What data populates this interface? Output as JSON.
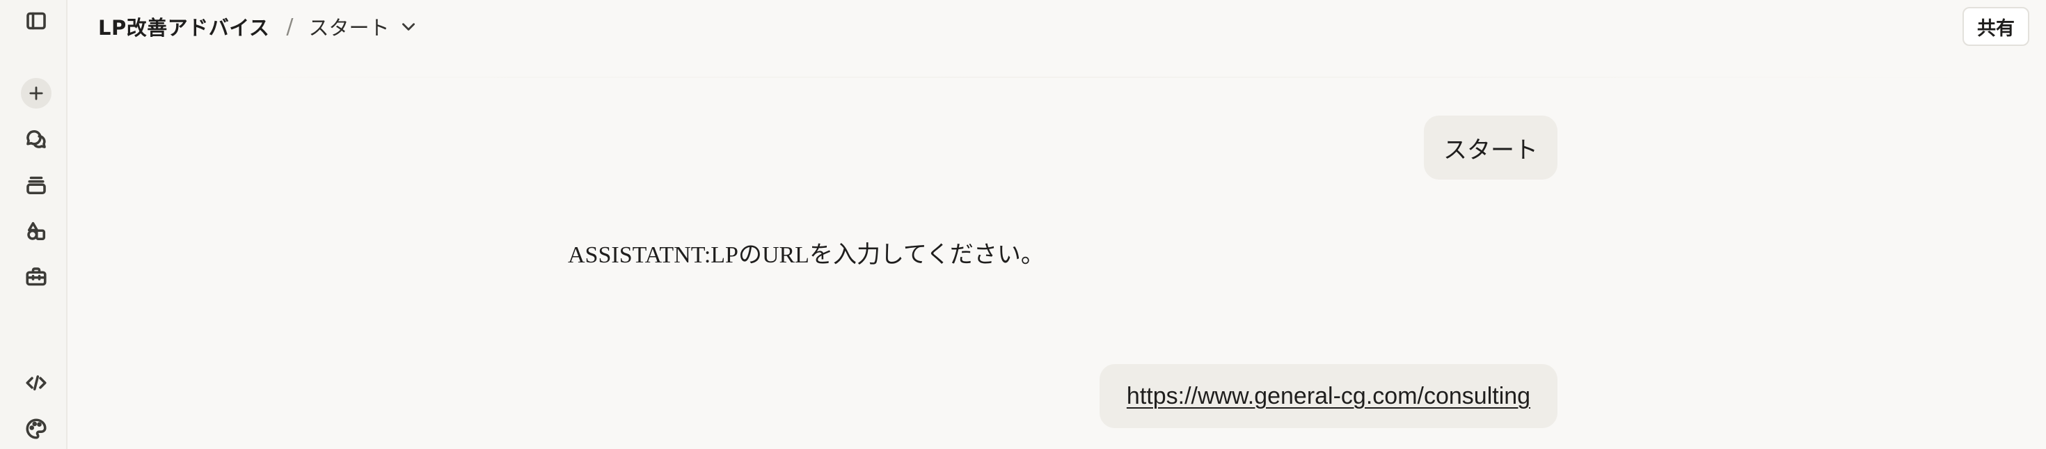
{
  "header": {
    "project_name": "LP改善アドバイス",
    "separator": "/",
    "chat_title": "スタート",
    "share_label": "共有"
  },
  "sidebar": {
    "items": [
      {
        "icon": "sidebar-toggle-icon"
      },
      {
        "icon": "plus-icon"
      },
      {
        "icon": "chats-icon"
      },
      {
        "icon": "projects-icon"
      },
      {
        "icon": "artifacts-icon"
      },
      {
        "icon": "briefcase-icon"
      },
      {
        "icon": "code-icon"
      },
      {
        "icon": "palette-icon"
      }
    ]
  },
  "messages": [
    {
      "role": "user",
      "text": "スタート"
    },
    {
      "role": "assistant",
      "text": "ASSISTATNT:LPのURLを入力してください。"
    },
    {
      "role": "user",
      "text": "https://www.general-cg.com/consulting"
    }
  ]
}
